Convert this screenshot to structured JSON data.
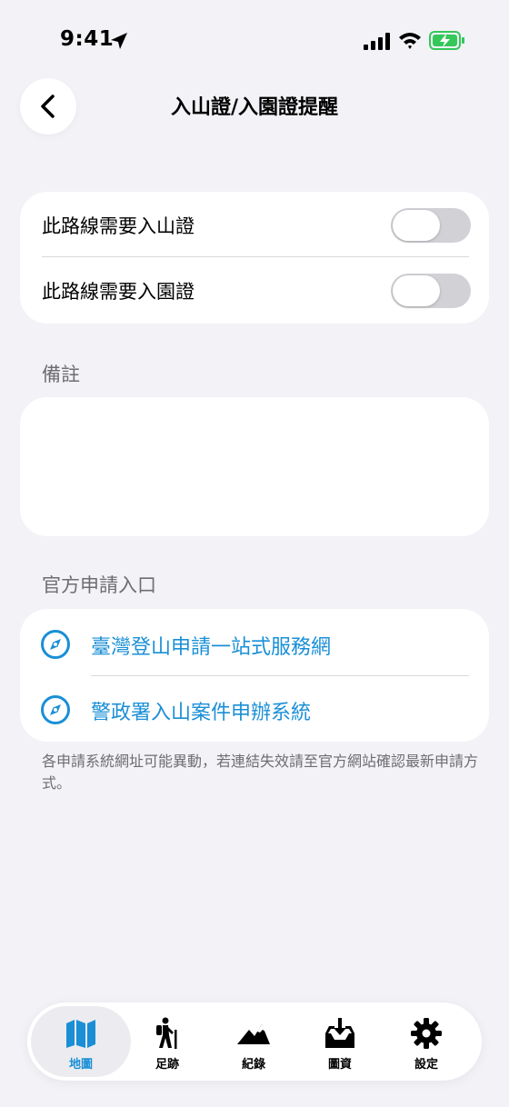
{
  "status_bar": {
    "time": "9:41"
  },
  "nav": {
    "title": "入山證/入園證提醒"
  },
  "permits": {
    "items": [
      {
        "label": "此路線需要入山證",
        "enabled": false
      },
      {
        "label": "此路線需要入園證",
        "enabled": false
      }
    ]
  },
  "notes": {
    "header": "備註",
    "value": ""
  },
  "official_links": {
    "header": "官方申請入口",
    "items": [
      {
        "label": "臺灣登山申請一站式服務網",
        "icon": "compass-icon"
      },
      {
        "label": "警政署入山案件申辦系統",
        "icon": "compass-icon"
      }
    ],
    "footnote": "各申請系統網址可能異動，若連結失效請至官方網站確認最新申請方式。"
  },
  "tab_bar": {
    "items": [
      {
        "label": "地圖",
        "icon": "map-icon",
        "active": true
      },
      {
        "label": "足跡",
        "icon": "hiker-icon",
        "active": false
      },
      {
        "label": "紀錄",
        "icon": "mountains-icon",
        "active": false
      },
      {
        "label": "圖資",
        "icon": "download-tray-icon",
        "active": false
      },
      {
        "label": "設定",
        "icon": "gear-icon",
        "active": false
      }
    ]
  },
  "colors": {
    "accent": "#1a8fd6",
    "background": "#f2f2f7",
    "toggle_off": "#d1d1d6",
    "battery": "#34c759"
  }
}
